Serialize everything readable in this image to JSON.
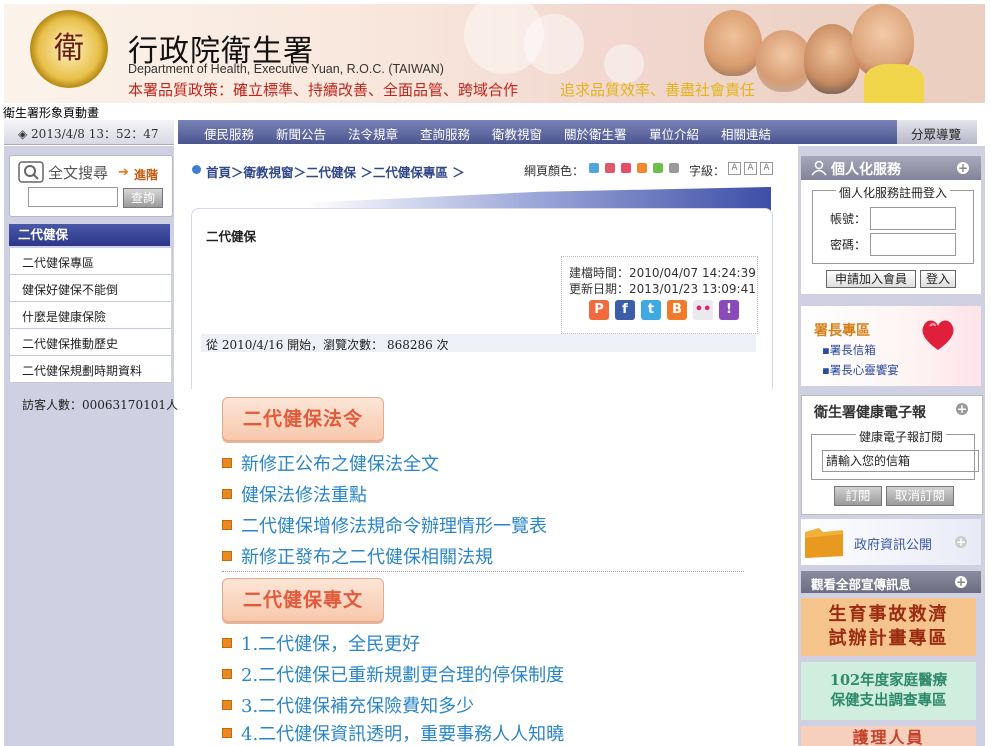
{
  "header": {
    "title": "行政院衛生署",
    "subtitle_en": "Department of Health, Executive Yuan, R.O.C. (TAIWAN)",
    "policy": "本署品質政策：確立標準、持續改善、全面品管、跨域合作",
    "slogan": "追求品質效率、善盡社會責任",
    "logo_glyph": "衛"
  },
  "anim_label": "衛生署形象頁動畫",
  "datebar": {
    "icon": "diamond-icon",
    "text": "◈ 2013/4/8  13：52：47"
  },
  "nav": {
    "items": [
      "便民服務",
      "新聞公告",
      "法令規章",
      "查詢服務",
      "衛教視窗",
      "關於衛生署",
      "單位介紹",
      "相關連結"
    ],
    "guide": "分眾導覽"
  },
  "search": {
    "title": "全文搜尋",
    "advanced": "進階",
    "button": "查詢",
    "value": ""
  },
  "left_menu": {
    "header": "二代健保",
    "items": [
      "二代健保專區",
      "健保好健保不能倒",
      "什麼是健康保險",
      "二代健保推動歷史",
      "二代健保規劃時期資料"
    ]
  },
  "visitors": "訪客人數：00063170101人",
  "breadcrumb": "首頁＞衛教視窗＞二代健保 ＞二代健保專區 ＞",
  "page_color_label": "網頁顏色：",
  "page_colors": [
    "#4fa7e0",
    "#e0566b",
    "#e64c6a",
    "#f08a2c",
    "#6cc04a",
    "#9a9a9a"
  ],
  "font_size_label": "字級：",
  "font_buttons": [
    "A",
    "A",
    "A"
  ],
  "content": {
    "title": "二代健保",
    "created": "建檔時間：2010/04/07 14:24:39",
    "updated": "更新日期：2013/01/23 13:09:41",
    "share": [
      {
        "name": "plurk-icon",
        "glyph": "P",
        "color": "#f36a3c"
      },
      {
        "name": "facebook-icon",
        "glyph": "f",
        "color": "#3b5ea8"
      },
      {
        "name": "twitter-icon",
        "glyph": "t",
        "color": "#3fa9e1"
      },
      {
        "name": "blogger-icon",
        "glyph": "B",
        "color": "#f07b2a"
      },
      {
        "name": "flickr-icon",
        "glyph": "••",
        "color": "#e9e9ef"
      },
      {
        "name": "yahoo-icon",
        "glyph": "!",
        "color": "#8a4bb8"
      }
    ],
    "views": "從 2010/4/16 開始，瀏覽次數： 868286 次"
  },
  "sections": [
    {
      "badge": "二代健保法令",
      "items": [
        "新修正公布之健保法全文",
        "健保法修法重點",
        "二代健保增修法規命令辦理情形一覽表",
        "新修正發布之二代健保相關法規"
      ]
    },
    {
      "badge": "二代健保專文",
      "items": [
        "1.二代健保，全民更好",
        "2.二代健保已重新規劃更合理的停保制度",
        "3.二代健保補充保險費知多少",
        "4.二代健保資訊透明，重要事務人人知曉"
      ]
    }
  ],
  "right": {
    "personal_title": "個人化服務",
    "login_legend": "個人化服務註冊登入",
    "account_label": "帳號：",
    "password_label": "密碼：",
    "apply_button": "申請加入會員",
    "login_button": "登入",
    "minister_title": "署長專區",
    "minister_links": [
      "署長信箱",
      "署長心靈饗宴"
    ],
    "news_title": "衛生署健康電子報",
    "news_legend": "健康電子報訂閱",
    "email_placeholder": "請輸入您的信箱",
    "subscribe": "訂閱",
    "unsubscribe": "取消訂閱",
    "gov_info": "政府資訊公開",
    "all_promo": "觀看全部宣傳訊息",
    "banners": [
      "生育事故救濟\n試辦計畫專區",
      "102年度家庭醫療\n保健支出調查專區",
      "護理人員"
    ]
  }
}
